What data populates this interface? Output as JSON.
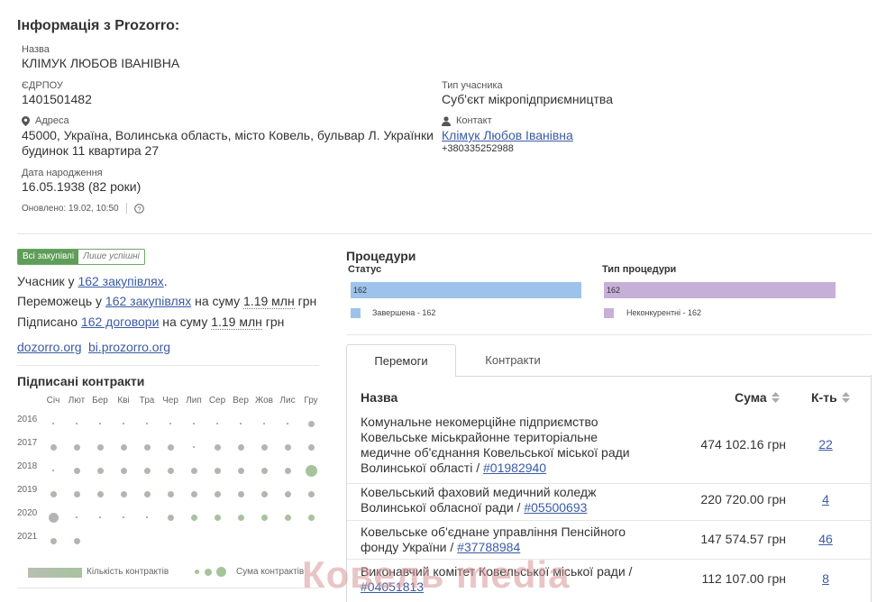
{
  "header": {
    "title": "Інформація з Prozorro:"
  },
  "profile": {
    "name_label": "Назва",
    "name": "КЛІМУК ЛЮБОВ ІВАНІВНА",
    "edrpou_label": "ЄДРПОУ",
    "edrpou": "1401501482",
    "participant_type_label": "Тип учасника",
    "participant_type": "Суб'єкт мікропідприємництва",
    "address_label": "Адреса",
    "address_line1": "45000, Україна, Волинська область, місто Ковель, бульвар Л. Українки",
    "address_line2": "будинок 11 квартира 27",
    "contact_label": "Контакт",
    "contact_name": "Клімук Любов Іванівна",
    "contact_phone": "+380335252988",
    "birth_label": "Дата народження",
    "birth": "16.05.1938 (82 роки)",
    "updated": "Оновлено: 19.02, 10:50"
  },
  "filter": {
    "all": "Всі закупівлі",
    "success": "Лише успішні"
  },
  "stats": {
    "participant_prefix": "Учасник у ",
    "participant_link": "162 закупівлях",
    "participant_suffix": ".",
    "winner_prefix": "Переможець у ",
    "winner_link": "162 закупівлях",
    "winner_mid": " на суму ",
    "winner_sum": "1.19 млн",
    "winner_suffix": " грн",
    "signed_prefix": "Підписано ",
    "signed_link": "162 договори",
    "signed_mid": " на суму ",
    "signed_sum": "1.19 млн",
    "signed_suffix": " грн"
  },
  "links": {
    "dozorro": "dozorro.org",
    "bi": "bi.prozorro.org"
  },
  "contracts": {
    "title": "Підписані контракти",
    "months": [
      "Січ",
      "Лют",
      "Бер",
      "Кві",
      "Тра",
      "Чер",
      "Лип",
      "Сер",
      "Вер",
      "Жов",
      "Лис",
      "Гру"
    ],
    "years": [
      "2016",
      "2017",
      "2018",
      "2019",
      "2020",
      "2021"
    ],
    "legend_count": "Кількість контрактів",
    "legend_sum": "Сума контрактів"
  },
  "procedures": {
    "title": "Процедури",
    "status_label": "Статус",
    "status_bar": "162",
    "status_legend": "Завершена - 162",
    "type_label": "Тип процедури",
    "type_bar": "162",
    "type_legend": "Неконкурентні - 162",
    "colors": {
      "status": "#9dc3eb",
      "type": "#c6b0d8"
    }
  },
  "tabs": {
    "wins": "Перемоги",
    "contracts": "Контракти"
  },
  "table": {
    "col_name": "Назва",
    "col_sum": "Сума",
    "col_count": "К-ть",
    "rows": [
      {
        "line1": "Комунальне некомерційне підприємство",
        "line2": "Ковельське міськрайонне територіальне",
        "line3": "медичне об'єднання Ковельської міської ради",
        "line4": "Волинської області / ",
        "code": "#01982940",
        "sum": "474 102.16 грн",
        "count": "22"
      },
      {
        "line1": "Ковельський фаховий медичний коледж",
        "line2": "Волинської обласної ради / ",
        "code": "#05500693",
        "sum": "220 720.00 грн",
        "count": "4"
      },
      {
        "line1": "Ковельське об'єднане управління Пенсійного",
        "line2": "фонду України / ",
        "code": "#37788984",
        "sum": "147 574.57 грн",
        "count": "46"
      },
      {
        "line1": "Виконавчий комітет Ковельської міської ради /",
        "code": "#04051813",
        "sum": "112 107.00 грн",
        "count": "8"
      }
    ]
  },
  "watermark": "Ковель media"
}
